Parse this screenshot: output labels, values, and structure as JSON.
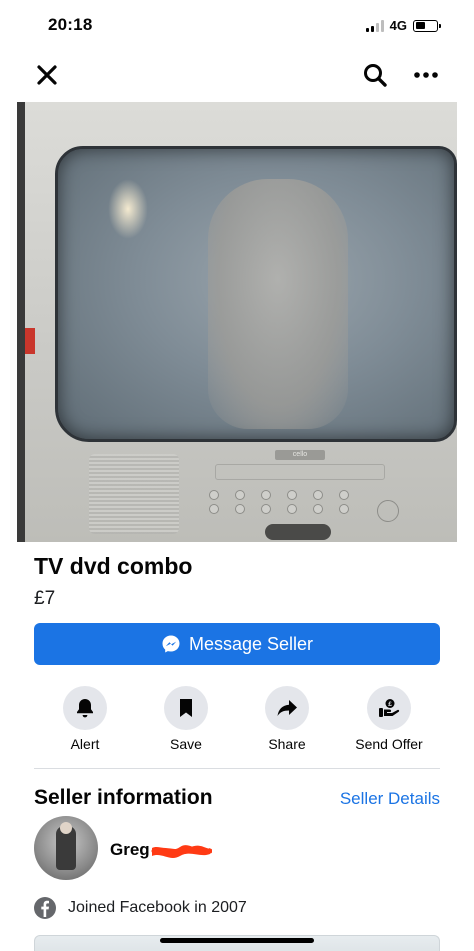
{
  "status_bar": {
    "time": "20:18",
    "network": "4G",
    "battery_level": 0.45
  },
  "nav": {
    "close_icon": "close-icon",
    "search_icon": "search-icon",
    "more_icon": "more-icon"
  },
  "listing": {
    "title": "TV dvd combo",
    "price": "£7",
    "photo_brand_text": "cello"
  },
  "message_button": {
    "label": "Message Seller",
    "color": "#1b74e4"
  },
  "actions": [
    {
      "label": "Alert",
      "icon": "bell-icon"
    },
    {
      "label": "Save",
      "icon": "bookmark-icon"
    },
    {
      "label": "Share",
      "icon": "share-arrow-icon"
    },
    {
      "label": "Send Offer",
      "icon": "offer-icon"
    }
  ],
  "seller": {
    "heading": "Seller information",
    "details_link": "Seller Details",
    "name": "Greg",
    "joined": "Joined Facebook in 2007"
  }
}
